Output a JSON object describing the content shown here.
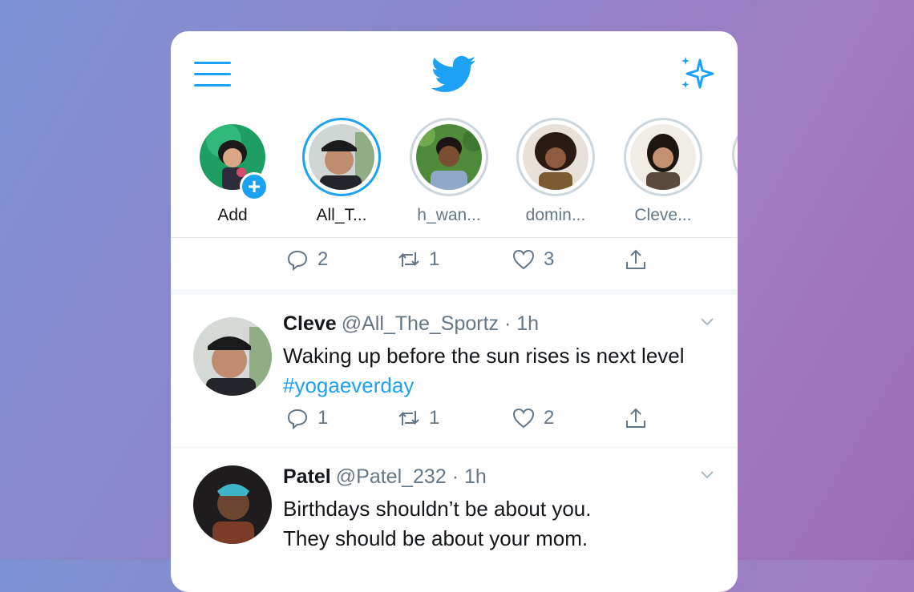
{
  "header": {
    "menu_icon": "hamburger-menu-icon",
    "logo_icon": "twitter-bird-icon",
    "sparkle_icon": "sparkle-icon",
    "accent_color": "#1da1f2"
  },
  "stories": [
    {
      "label": "Add",
      "icon": "plus-icon"
    },
    {
      "label": "All_T..."
    },
    {
      "label": "h_wan..."
    },
    {
      "label": "domin..."
    },
    {
      "label": "Cleve..."
    }
  ],
  "prev_tweet_actions": {
    "reply": "2",
    "retweet": "1",
    "like": "3"
  },
  "tweets": [
    {
      "name": "Cleve",
      "handle": "@All_The_Sportz",
      "time": "· 1h",
      "text_before": "Waking up before the sun rises is next level ",
      "hashtag": "#yogaeverday",
      "actions": {
        "reply": "1",
        "retweet": "1",
        "like": "2"
      }
    },
    {
      "name": "Patel",
      "handle": "@Patel_232",
      "time": "· 1h",
      "text_line1": "Birthdays shouldn’t be about you.",
      "text_line2": "They should be about your mom."
    }
  ]
}
